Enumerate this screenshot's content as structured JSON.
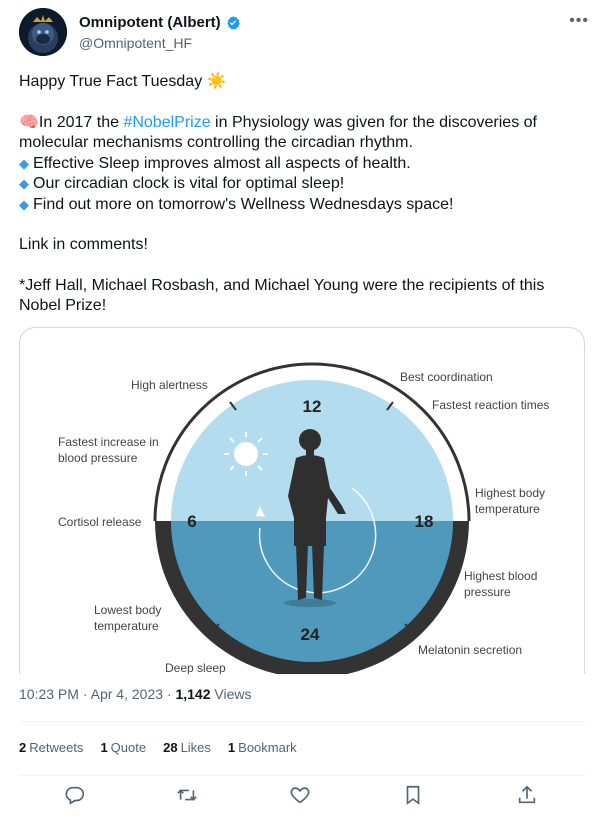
{
  "author": {
    "display_name": "Omnipotent (Albert)",
    "handle": "@Omnipotent_HF",
    "avatar_icon": "gorilla-avatar-icon"
  },
  "tweet": {
    "line1": "Happy True Fact Tuesday ☀️",
    "line2_pre": "🧠In 2017 the ",
    "hashtag": "#NobelPrize",
    "line2_post": " in Physiology was given for the discoveries of molecular mechanisms controlling the circadian rhythm.",
    "bullets": [
      "Effective Sleep improves almost all aspects of health.",
      "Our circadian clock is vital for optimal sleep!",
      "Find out more on tomorrow's Wellness Wednesdays space!"
    ],
    "link_line": "Link in comments!",
    "footnote": "*Jeff Hall, Michael Rosbash, and Michael Young were the recipients of this Nobel Prize!"
  },
  "figure": {
    "hours": {
      "top": "12",
      "left": "6",
      "right": "18",
      "bottom": "24"
    },
    "labels": {
      "high_alertness": "High alertness",
      "best_coordination": "Best coordination",
      "fastest_reaction": "Fastest reaction times",
      "bp_increase_1": "Fastest increase in",
      "bp_increase_2": "blood pressure",
      "cortisol": "Cortisol release",
      "highest_temp_1": "Highest body",
      "highest_temp_2": "temperature",
      "highest_bp_1": "Highest blood",
      "highest_bp_2": "pressure",
      "lowest_temp_1": "Lowest body",
      "lowest_temp_2": "temperature",
      "melatonin": "Melatonin secretion",
      "deep_sleep": "Deep sleep"
    }
  },
  "meta": {
    "time": "10:23 PM",
    "separator": "·",
    "date": "Apr 4, 2023",
    "views_count": "1,142",
    "views_label": "Views"
  },
  "stats": [
    {
      "count": "2",
      "label": "Retweets"
    },
    {
      "count": "1",
      "label": "Quote"
    },
    {
      "count": "28",
      "label": "Likes"
    },
    {
      "count": "1",
      "label": "Bookmark"
    }
  ],
  "colors": {
    "sky": "#b3dcee",
    "night": "#4f9abc",
    "ring_dark": "#333333",
    "link": "#1d9bf0"
  }
}
